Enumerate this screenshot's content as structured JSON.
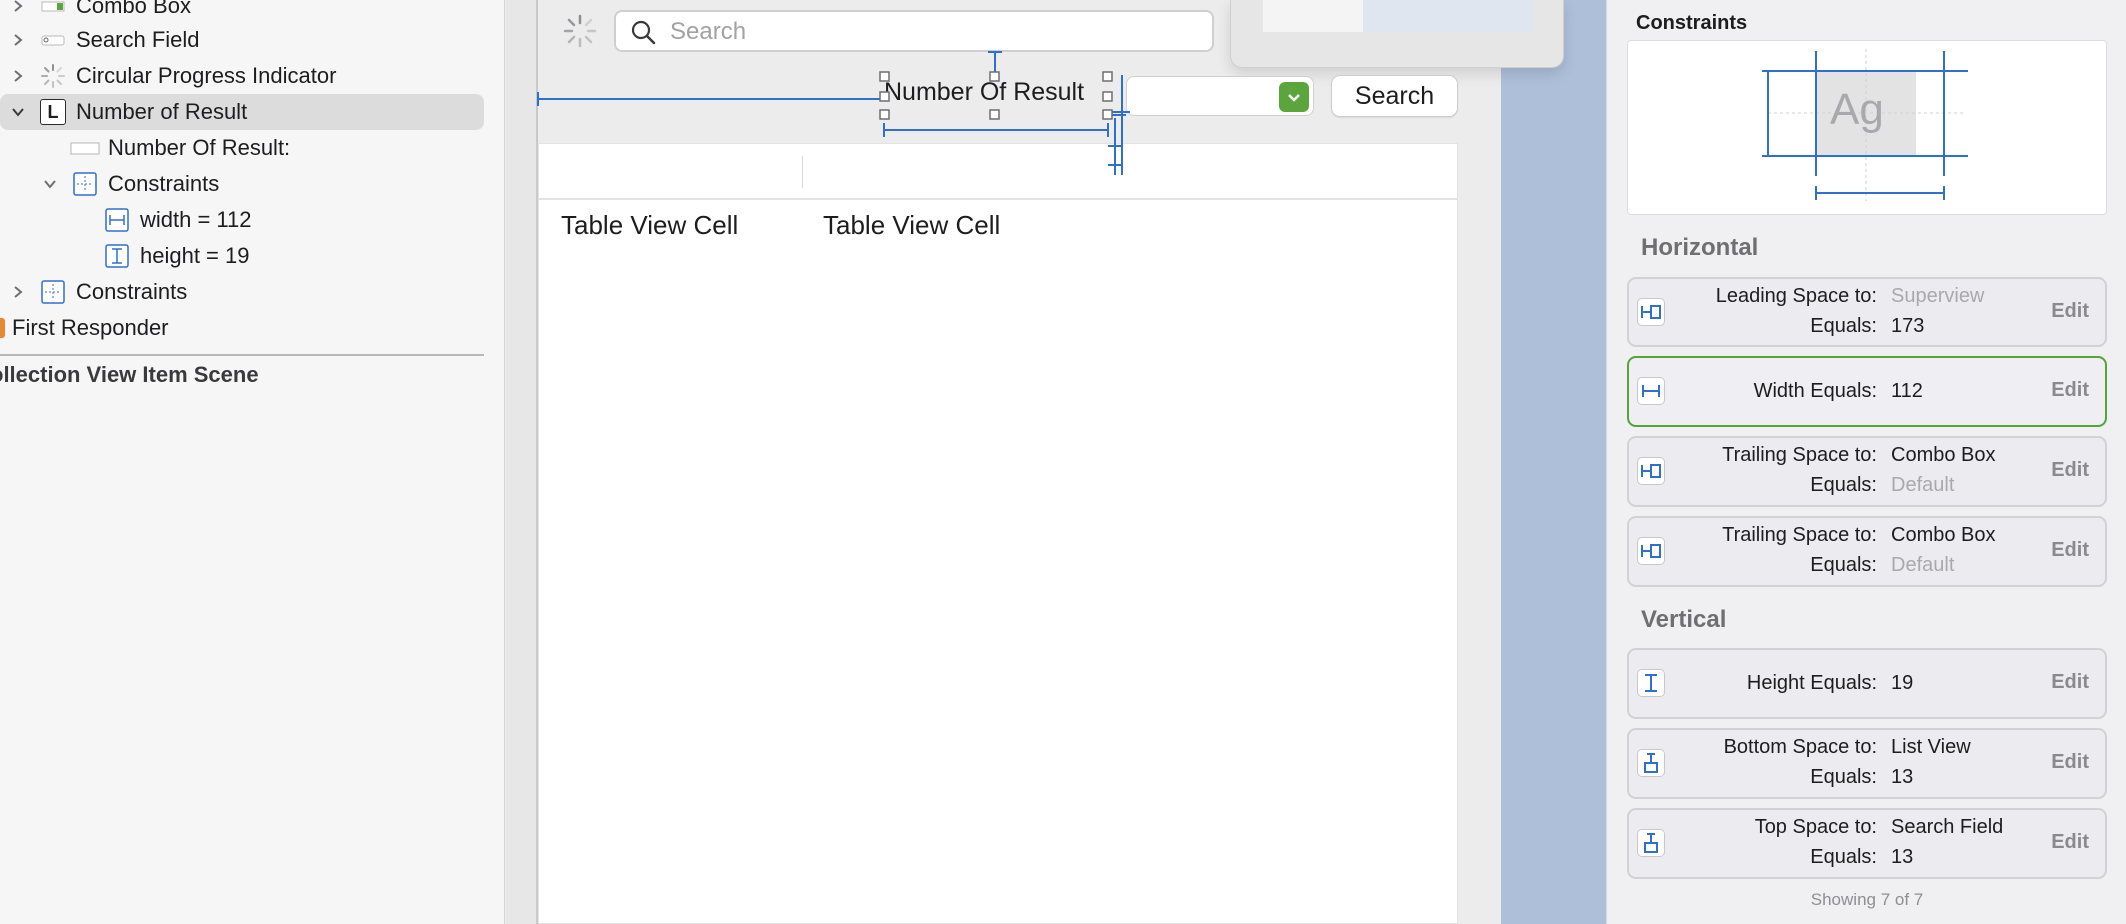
{
  "outline": {
    "rows": [
      {
        "label": "Combo Box",
        "expandable": true
      },
      {
        "label": "Search Field",
        "expandable": true
      },
      {
        "label": "Circular Progress Indicator",
        "expandable": true
      },
      {
        "label": "Number of Result",
        "expandable": true,
        "expanded": true,
        "selected": true,
        "icon_glyph": "L"
      },
      {
        "label": "Number Of Result:",
        "expandable": false
      },
      {
        "label": "Constraints",
        "expandable": true,
        "expanded": true
      },
      {
        "label": "width = 112",
        "expandable": false
      },
      {
        "label": "height = 19",
        "expandable": false
      },
      {
        "label": "Constraints",
        "expandable": true
      },
      {
        "label": "First Responder",
        "expandable": false
      }
    ],
    "scene_title": "ollection View Item Scene"
  },
  "canvas": {
    "search_placeholder": "Search",
    "number_label": "Number Of Result",
    "search_button": "Search",
    "table_cells": [
      "Table View Cell",
      "Table View Cell"
    ]
  },
  "inspector": {
    "title": "Constraints",
    "preview_text": "Ag",
    "horizontal_header": "Horizontal",
    "vertical_header": "Vertical",
    "edit_label": "Edit",
    "horizontal": [
      {
        "lab1": "Leading Space to:",
        "val1": "Superview",
        "val1_muted": true,
        "lab2": "Equals:",
        "val2": "173",
        "val2_muted": false,
        "icon": "leading-space-icon"
      },
      {
        "lab1": "Width Equals:",
        "val1": "112",
        "val1_muted": false,
        "icon": "width-icon",
        "highlighted": true
      },
      {
        "lab1": "Trailing Space to:",
        "val1": "Combo Box",
        "val1_muted": false,
        "lab2": "Equals:",
        "val2": "Default",
        "val2_muted": true,
        "icon": "trailing-space-icon"
      },
      {
        "lab1": "Trailing Space to:",
        "val1": "Combo Box",
        "val1_muted": false,
        "lab2": "Equals:",
        "val2": "Default",
        "val2_muted": true,
        "icon": "trailing-space-icon"
      }
    ],
    "vertical": [
      {
        "lab1": "Height Equals:",
        "val1": "19",
        "val1_muted": false,
        "icon": "height-icon"
      },
      {
        "lab1": "Bottom Space to:",
        "val1": "List View",
        "val1_muted": false,
        "lab2": "Equals:",
        "val2": "13",
        "val2_muted": false,
        "icon": "bottom-space-icon"
      },
      {
        "lab1": "Top Space to:",
        "val1": "Search Field",
        "val1_muted": false,
        "lab2": "Equals:",
        "val2": "13",
        "val2_muted": false,
        "icon": "top-space-icon"
      }
    ],
    "showing": "Showing 7 of 7"
  },
  "colors": {
    "accent_blue": "#2f6fd0",
    "selection_green": "#56a33a",
    "combo_button_green": "#5aa63d",
    "first_responder_orange": "#e6892e"
  }
}
